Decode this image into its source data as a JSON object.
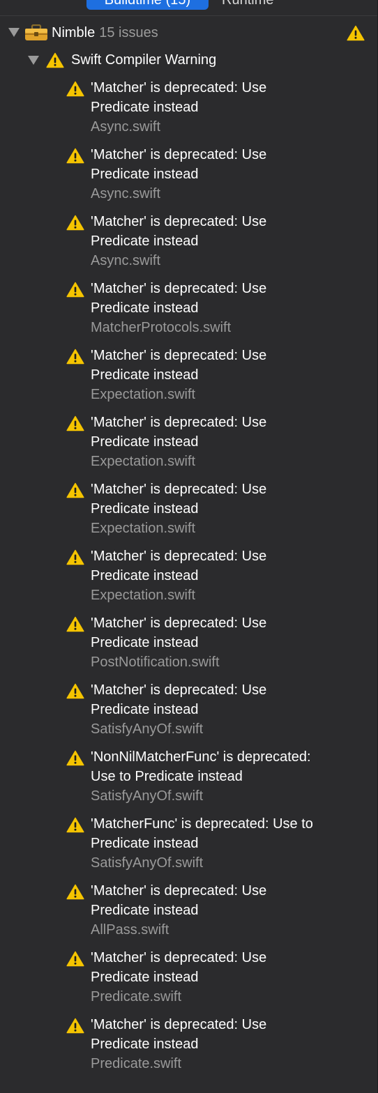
{
  "segmented_control": {
    "active_label": "Buildtime (15)",
    "inactive_label": "Runtime"
  },
  "colors": {
    "background": "#2b2b2d",
    "accent": "#1e6fe0",
    "warning": "#f5c400",
    "secondary_text": "#9a9a9a"
  },
  "project": {
    "name": "Nimble",
    "issue_count": "15 issues",
    "icon": "toolbox-icon",
    "status_icon": "warning-icon"
  },
  "group": {
    "title": "Swift Compiler Warning",
    "icon": "warning-icon"
  },
  "issues": [
    {
      "message": "'Matcher' is deprecated: Use\nPredicate instead",
      "file": "Async.swift"
    },
    {
      "message": "'Matcher' is deprecated: Use\nPredicate instead",
      "file": "Async.swift"
    },
    {
      "message": "'Matcher' is deprecated: Use\nPredicate instead",
      "file": "Async.swift"
    },
    {
      "message": "'Matcher' is deprecated: Use\nPredicate instead",
      "file": "MatcherProtocols.swift"
    },
    {
      "message": "'Matcher' is deprecated: Use\nPredicate instead",
      "file": "Expectation.swift"
    },
    {
      "message": "'Matcher' is deprecated: Use\nPredicate instead",
      "file": "Expectation.swift"
    },
    {
      "message": "'Matcher' is deprecated: Use\nPredicate instead",
      "file": "Expectation.swift"
    },
    {
      "message": "'Matcher' is deprecated: Use\nPredicate instead",
      "file": "Expectation.swift"
    },
    {
      "message": "'Matcher' is deprecated: Use\nPredicate instead",
      "file": "PostNotification.swift"
    },
    {
      "message": "'Matcher' is deprecated: Use\nPredicate instead",
      "file": "SatisfyAnyOf.swift"
    },
    {
      "message": "'NonNilMatcherFunc' is deprecated:\nUse to Predicate instead",
      "file": "SatisfyAnyOf.swift"
    },
    {
      "message": "'MatcherFunc' is deprecated: Use to\nPredicate instead",
      "file": "SatisfyAnyOf.swift"
    },
    {
      "message": "'Matcher' is deprecated: Use\nPredicate instead",
      "file": "AllPass.swift"
    },
    {
      "message": "'Matcher' is deprecated: Use\nPredicate instead",
      "file": "Predicate.swift"
    },
    {
      "message": "'Matcher' is deprecated: Use\nPredicate instead",
      "file": "Predicate.swift"
    }
  ]
}
